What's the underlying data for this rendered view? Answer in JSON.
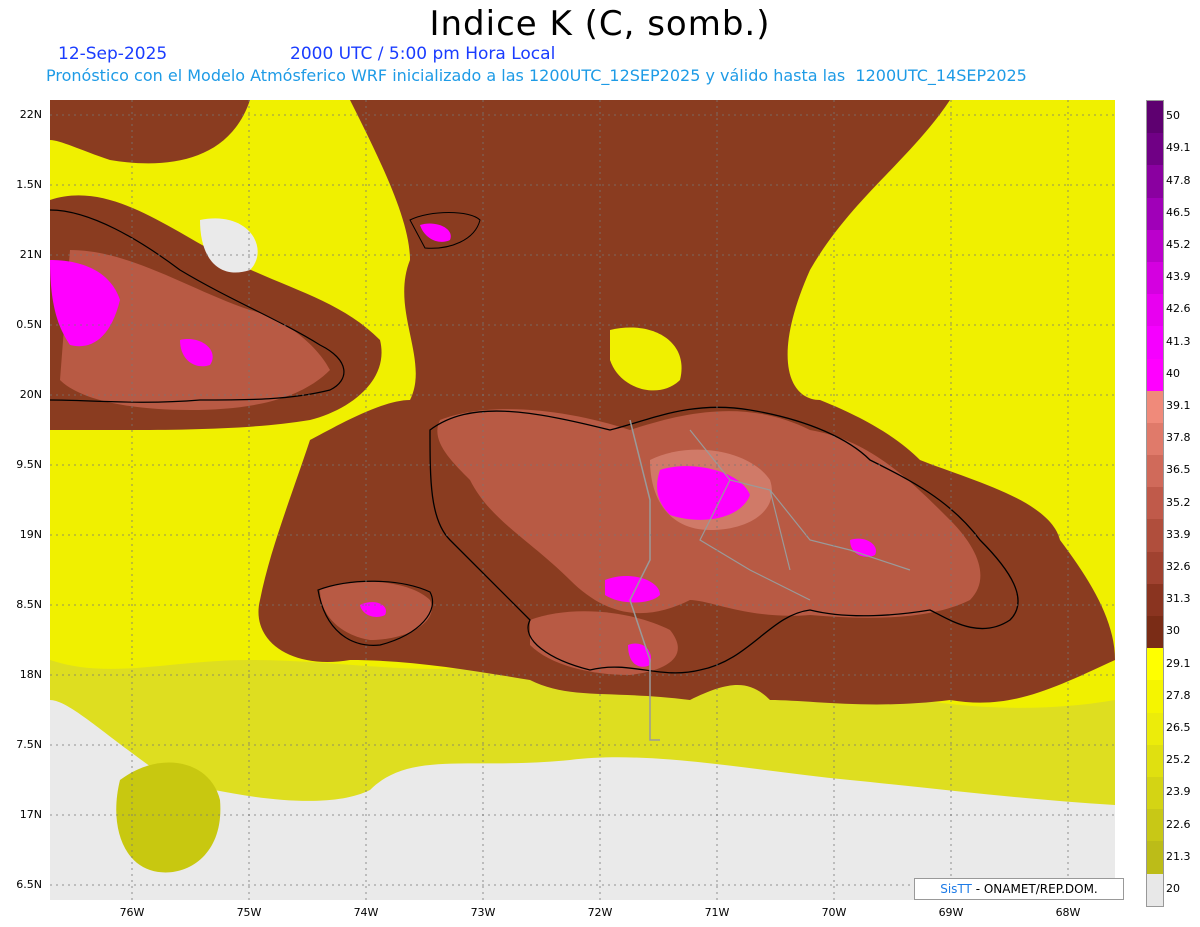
{
  "title": "Indice K (C, somb.)",
  "date": "12-Sep-2025",
  "time": "2000 UTC / 5:00 pm Hora Local",
  "forecast": "Pronóstico con el Modelo Atmósferico WRF inicializado a las 1200UTC_12SEP2025 y válido hasta las  1200UTC_14SEP2025",
  "credit_brand": "SisTT",
  "credit_org": " - ONAMET/REP.DOM.",
  "lat_labels": [
    "22N",
    "1.5N",
    "21N",
    "0.5N",
    "20N",
    "9.5N",
    "19N",
    "8.5N",
    "18N",
    "7.5N",
    "17N",
    "6.5N"
  ],
  "lon_labels": [
    "76W",
    "75W",
    "74W",
    "73W",
    "72W",
    "71W",
    "70W",
    "69W",
    "68W"
  ],
  "colorbar_labels": [
    "50",
    "49.1",
    "47.8",
    "46.5",
    "45.2",
    "43.9",
    "42.6",
    "41.3",
    "40",
    "39.1",
    "37.8",
    "36.5",
    "35.2",
    "33.9",
    "32.6",
    "31.3",
    "30",
    "29.1",
    "27.8",
    "26.5",
    "25.2",
    "23.9",
    "22.6",
    "21.3",
    "20"
  ],
  "colorbar_colors": [
    "#5e0070",
    "#700085",
    "#8a00a0",
    "#a000b8",
    "#bb00cc",
    "#d400e0",
    "#e800f0",
    "#f500ff",
    "#ff00ff",
    "#f08a7a",
    "#e07a6a",
    "#d06a5a",
    "#c05a4a",
    "#b04e3c",
    "#a04230",
    "#8a3420",
    "#7a2c16",
    "#ffff00",
    "#f5f500",
    "#ecec0a",
    "#e0e010",
    "#d4d414",
    "#c8c816",
    "#bcbc18",
    "#e8e8e8"
  ],
  "colors": {
    "yellow": "#f0f000",
    "brown": "#8a3c20",
    "midbrown": "#a84a34",
    "pink": "#c87060",
    "magenta": "#ff00ff",
    "land_border": "#000000",
    "province_border": "#9a9a9a",
    "grid": "#777777"
  }
}
